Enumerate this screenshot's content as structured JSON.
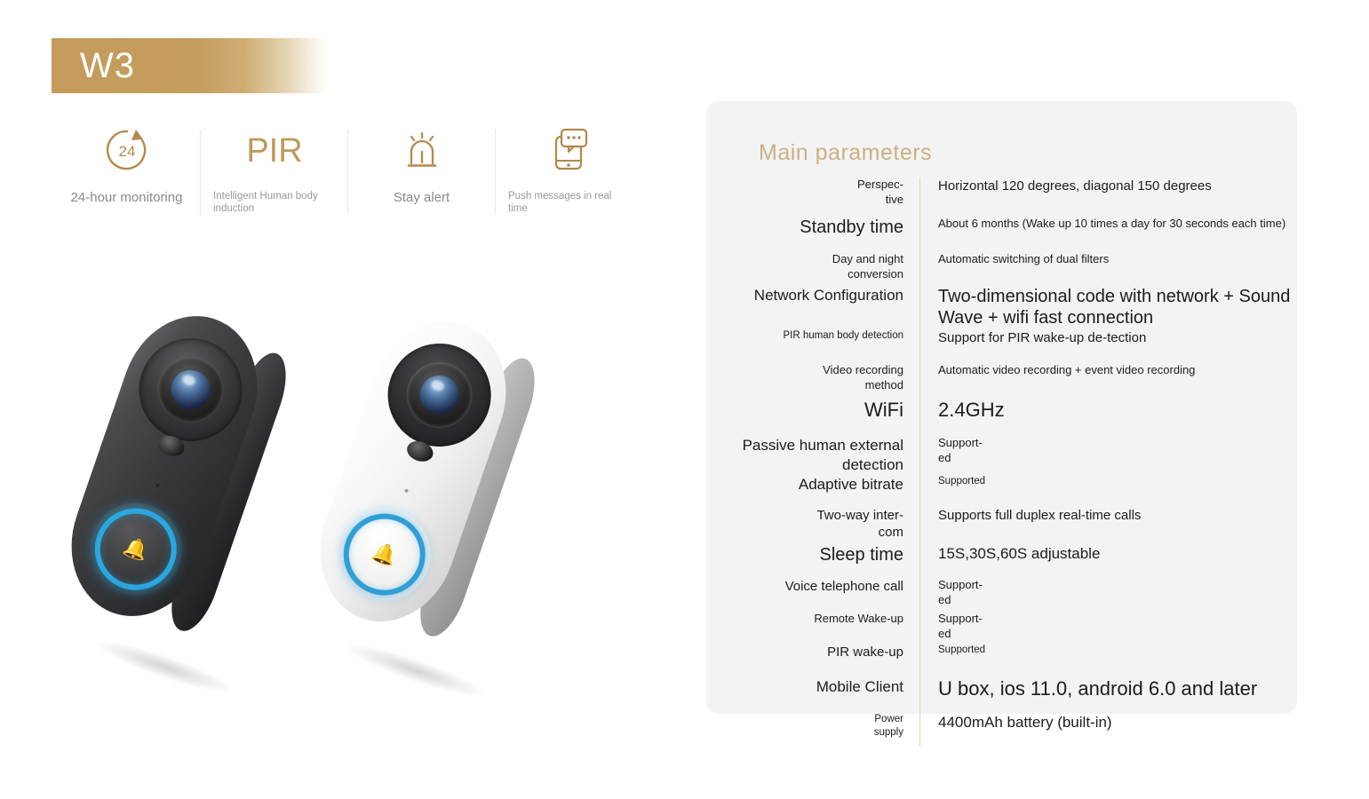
{
  "banner": {
    "model": "W3"
  },
  "features": [
    {
      "icon": "24-hour-clock-icon",
      "label": "24-hour monitoring",
      "size": "big"
    },
    {
      "icon": "pir-text-icon",
      "label": "Intelligent Human body induction",
      "size": "small"
    },
    {
      "icon": "alarm-siren-icon",
      "label": "Stay alert",
      "size": "big"
    },
    {
      "icon": "phone-push-message-icon",
      "label": "Push messages in real time",
      "size": "small"
    }
  ],
  "products": [
    {
      "name": "doorbell-dark",
      "color_label": "dark grey",
      "button_ring_color": "#2aa7e0"
    },
    {
      "name": "doorbell-white",
      "color_label": "white",
      "button_ring_color": "#2f9fd6"
    }
  ],
  "panel": {
    "title": "Main parameters",
    "accent_color": "#c9b184",
    "background_color": "#f3f3f3",
    "divider_color": "#e0d6bd",
    "rows": [
      {
        "key": "Perspec-\ntive",
        "key_size": "s-sm",
        "value": "Horizontal 120 degrees, diagonal 150 degrees",
        "value_size": "s-md"
      },
      {
        "key": "Standby time",
        "key_size": "s-xl",
        "value": "About 6 months (Wake up 10 times a day for 30 seconds each time)",
        "value_size": "s-sm"
      },
      {
        "key": "Day and night\nconversion",
        "key_size": "s-sm",
        "value": "Automatic switching of dual filters",
        "value_size": "s-sm"
      },
      {
        "key": "Network Configuration",
        "key_size": "s-lg",
        "value": "Two-dimensional code with network + Sound Wave + wifi fast connection",
        "value_size": "s-xl"
      },
      {
        "key": "PIR human body detection",
        "key_size": "s-xs",
        "value": "Support for PIR wake-up de-tection",
        "value_size": "s-md"
      },
      {
        "key": "Video recording\nmethod",
        "key_size": "s-sm",
        "value": "Automatic video recording + event video recording",
        "value_size": "s-sm"
      },
      {
        "key": "WiFi",
        "key_size": "s-xxl",
        "value": "2.4GHz",
        "value_size": "s-xxl"
      },
      {
        "key": "Passive human external\ndetection",
        "key_size": "s-lg",
        "value": "Support-\ned",
        "value_size": "s-sm"
      },
      {
        "key": "Adaptive bitrate",
        "key_size": "s-lg",
        "value": "Supported",
        "value_size": "s-xs"
      },
      {
        "key": "Two-way inter-\ncom",
        "key_size": "s-md",
        "value": "Supports full duplex real-time calls",
        "value_size": "s-md"
      },
      {
        "key": "Sleep time",
        "key_size": "s-xl",
        "value": "15S,30S,60S adjustable",
        "value_size": "s-lg"
      },
      {
        "key": "Voice telephone call",
        "key_size": "s-md",
        "value": "Support-\ned",
        "value_size": "s-sm"
      },
      {
        "key": "Remote Wake-up",
        "key_size": "s-sm",
        "value": "Support-\ned",
        "value_size": "s-sm"
      },
      {
        "key": "PIR wake-up",
        "key_size": "s-md",
        "value": "Supported",
        "value_size": "s-xs"
      },
      {
        "key": "Mobile Client",
        "key_size": "s-lg",
        "value": "U box, ios 11.0, android 6.0 and later",
        "value_size": "s-xxl"
      },
      {
        "key": "Power\nsupply",
        "key_size": "s-xs",
        "value": "4400mAh battery (built-in)",
        "value_size": "s-lg"
      }
    ]
  }
}
